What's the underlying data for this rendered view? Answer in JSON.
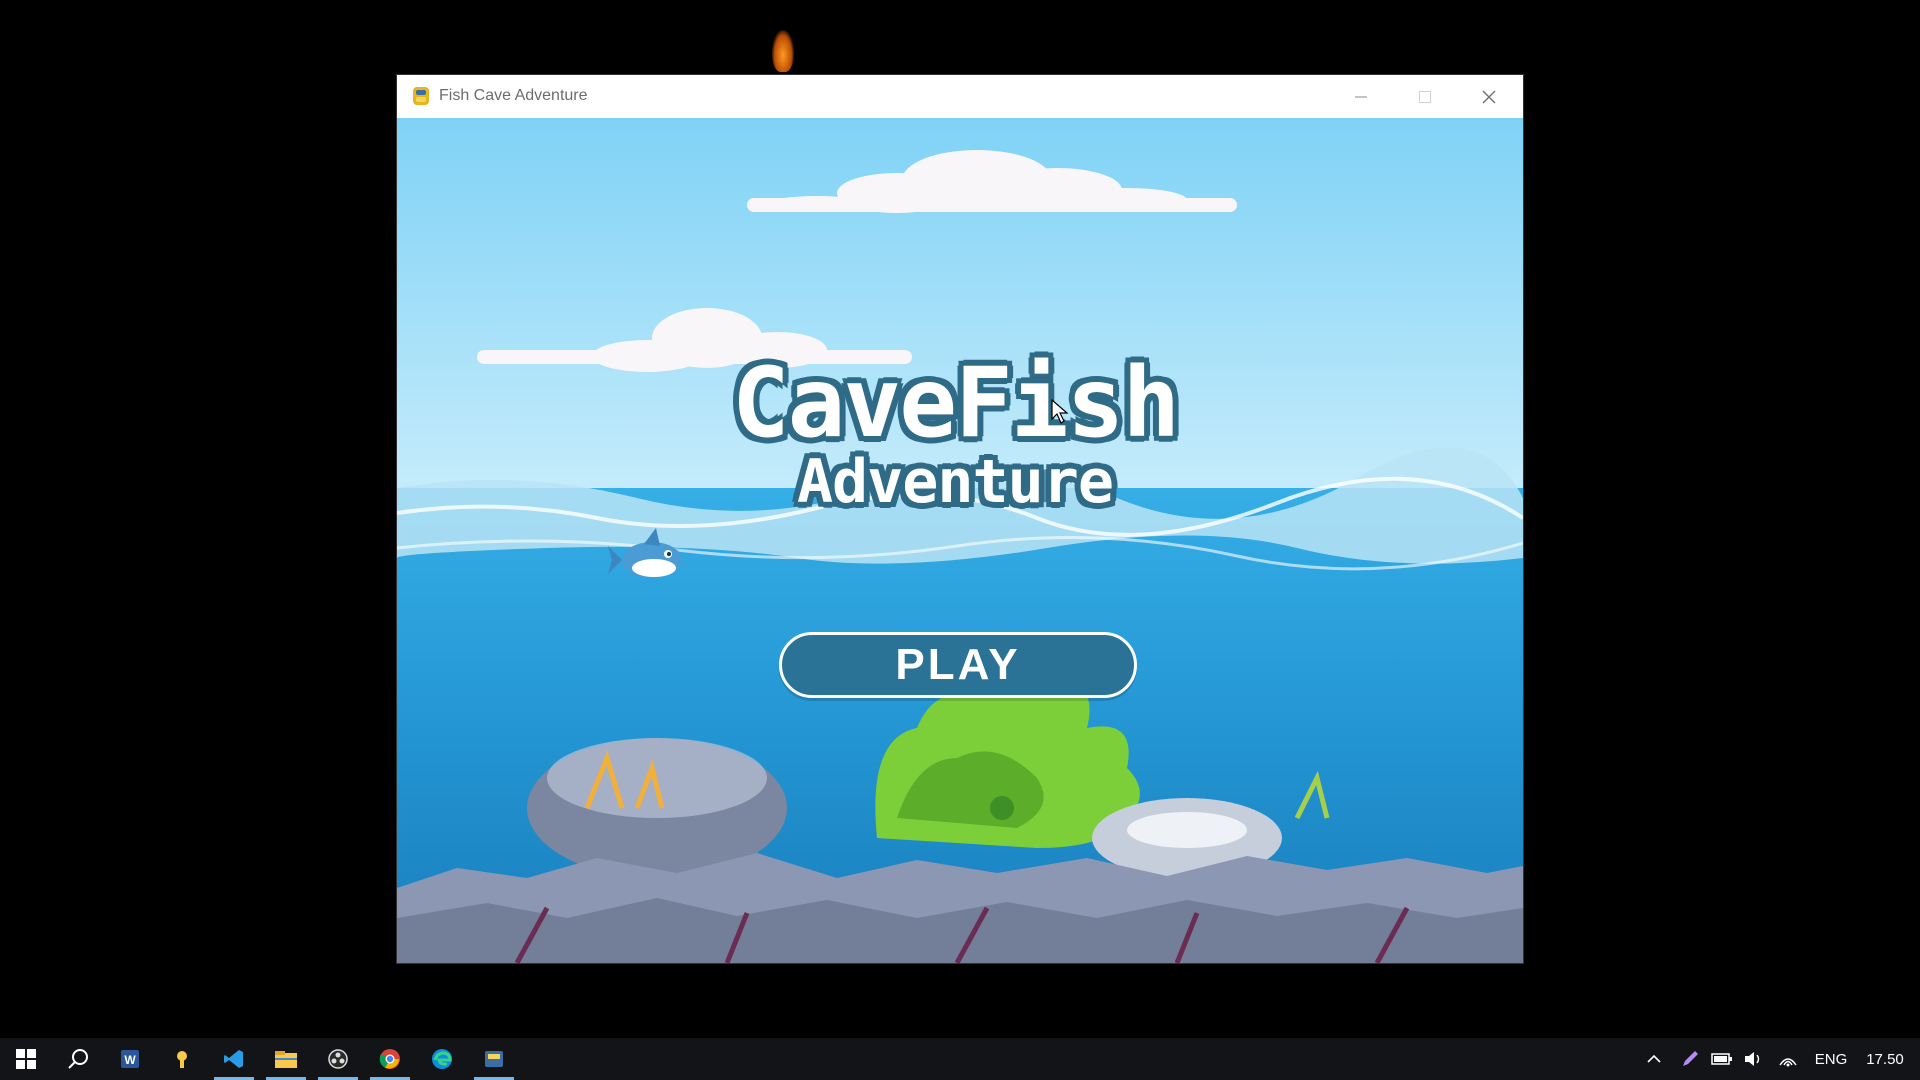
{
  "window": {
    "title": "Fish Cave Adventure"
  },
  "game": {
    "logo_line1": "CaveFish",
    "logo_line2": "Adventure",
    "play_label": "PLAY",
    "colors": {
      "sky_top": "#7fd2f6",
      "sky_bottom": "#c6ecfb",
      "sea_top": "#2fa4df",
      "sea_bottom": "#1b7fc0",
      "button": "#2a7296",
      "logo_outline": "#2f6b86"
    }
  },
  "taskbar": {
    "apps": [
      {
        "icon": "windows-start-icon"
      },
      {
        "icon": "search-icon"
      },
      {
        "icon": "word-icon"
      },
      {
        "icon": "lightbulb-icon"
      },
      {
        "icon": "vscode-icon"
      },
      {
        "icon": "file-explorer-icon"
      },
      {
        "icon": "obs-icon"
      },
      {
        "icon": "chrome-icon"
      },
      {
        "icon": "edge-icon"
      },
      {
        "icon": "python-app-icon"
      }
    ],
    "tray": {
      "language": "ENG",
      "time": "17.50"
    }
  }
}
